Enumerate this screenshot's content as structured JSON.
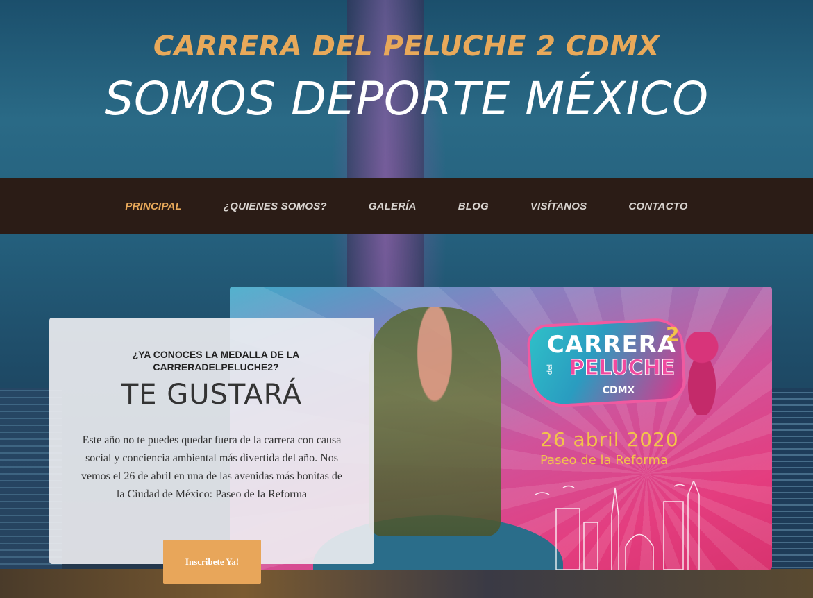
{
  "hero": {
    "subtitle": "CARRERA DEL PELUCHE 2 CDMX",
    "title": "SOMOS DEPORTE MÉXICO"
  },
  "nav": {
    "items": [
      {
        "label": "PRINCIPAL",
        "active": true
      },
      {
        "label": "¿QUIENES SOMOS?",
        "active": false
      },
      {
        "label": "GALERÍA",
        "active": false
      },
      {
        "label": "BLOG",
        "active": false
      },
      {
        "label": "VISÍTANOS",
        "active": false
      },
      {
        "label": "CONTACTO",
        "active": false
      }
    ]
  },
  "banner": {
    "logo_line1": "CARRERA",
    "logo_line2": "PELUCHE",
    "logo_del": "del",
    "logo_number": "2",
    "logo_city": "CDMX",
    "date": "26 abril 2020",
    "place": "Paseo de la Reforma"
  },
  "card": {
    "question": "¿YA CONOCES LA MEDALLA DE LA CARRERADELPELUCHE2?",
    "heading": "TE GUSTARÁ",
    "body": "Este año no te puedes quedar fuera de la carrera con causa social y conciencia ambiental más divertida del año. Nos vemos el 26 de abril en una de las avenidas más bonitas de la Ciudad de México: Paseo de la Reforma",
    "button_label": "Inscribete Ya!"
  },
  "colors": {
    "accent": "#e8a95a",
    "nav_bg": "#2b1c16",
    "nav_text": "#d9d4d0",
    "date_text": "#f3c34a"
  }
}
